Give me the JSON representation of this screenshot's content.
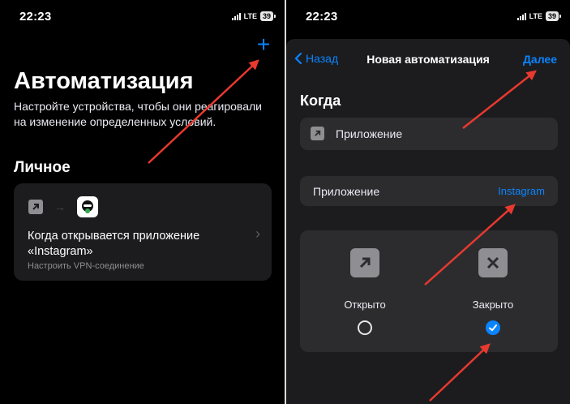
{
  "status_bar": {
    "time": "22:23",
    "network": "LTE",
    "battery": "39"
  },
  "left_screen": {
    "title": "Автоматизация",
    "description": "Настройте устройства, чтобы они реагировали на изменение определенных условий.",
    "section_title": "Личное",
    "automation_card": {
      "title": "Когда открывается приложение «Instagram»",
      "subtitle": "Настроить VPN-соединение"
    }
  },
  "right_screen": {
    "nav": {
      "back_label": "Назад",
      "title": "Новая автоматизация",
      "next_label": "Далее"
    },
    "when_title": "Когда",
    "trigger_row": {
      "label": "Приложение"
    },
    "app_row": {
      "label": "Приложение",
      "value": "Instagram"
    },
    "options": [
      {
        "label": "Открыто",
        "selected": false
      },
      {
        "label": "Закрыто",
        "selected": true
      }
    ]
  },
  "colors": {
    "accent": "#0a84ff",
    "annotation_arrow": "#e8392f"
  }
}
